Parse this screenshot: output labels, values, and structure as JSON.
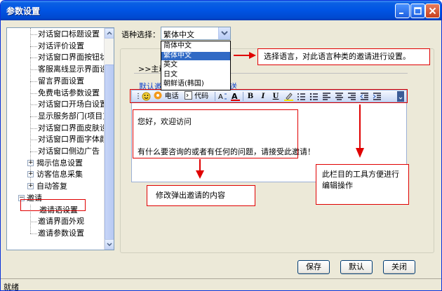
{
  "window": {
    "title": "参数设置"
  },
  "tree": {
    "items": [
      {
        "label": "对话窗口标题设置"
      },
      {
        "label": "对话评价设置"
      },
      {
        "label": "对话窗口界面按钮状态"
      },
      {
        "label": "客服离线显示界面设置"
      },
      {
        "label": "留言界面设置"
      },
      {
        "label": "免费电话参数设置"
      },
      {
        "label": "对话窗口开场白设置"
      },
      {
        "label": "显示服务部门(项目)设"
      },
      {
        "label": "对话窗口界面皮肤设置"
      },
      {
        "label": "对话窗口界面字体颜色"
      },
      {
        "label": "对话窗口侧边广告"
      },
      {
        "label": "揭示信息设置",
        "expander": "+"
      },
      {
        "label": "访客信息采集",
        "expander": "+"
      },
      {
        "label": "自动答复",
        "expander": "+"
      },
      {
        "label": "邀请",
        "expander": "−"
      },
      {
        "label": "邀请语设置",
        "selected": true
      },
      {
        "label": "邀请界面外观"
      },
      {
        "label": "邀请参数设置"
      }
    ]
  },
  "language": {
    "label": "语种选择：",
    "selected": "繁体中文",
    "options": [
      "简体中文",
      "繁体中文",
      "英文",
      "日文",
      "朝鲜语(韩国)"
    ]
  },
  "tabs": {
    "line_prefix": ">>主动",
    "link1": "默认邀",
    "link2": "送"
  },
  "toolbar": {
    "phone_label": "电话",
    "code_label": "代码",
    "bold": "B",
    "italic": "I",
    "underline": "U"
  },
  "editor": {
    "greeting": "您好，欢迎访问",
    "prompt": "有什么要咨询的或者有任何的问题，请接受此邀请！"
  },
  "notes": {
    "language": "选择语言，对此语言种类的邀请进行设置。",
    "content": "修改弹出邀请的内容",
    "toolbar": "此栏目的工具方便进行编辑操作"
  },
  "buttons": {
    "save": "保存",
    "default": "默认",
    "close": "关闭"
  },
  "status": {
    "text": "就绪"
  },
  "colors": {
    "accent": "#0054e3",
    "annotation": "#e00000",
    "selection": "#316ac5"
  }
}
